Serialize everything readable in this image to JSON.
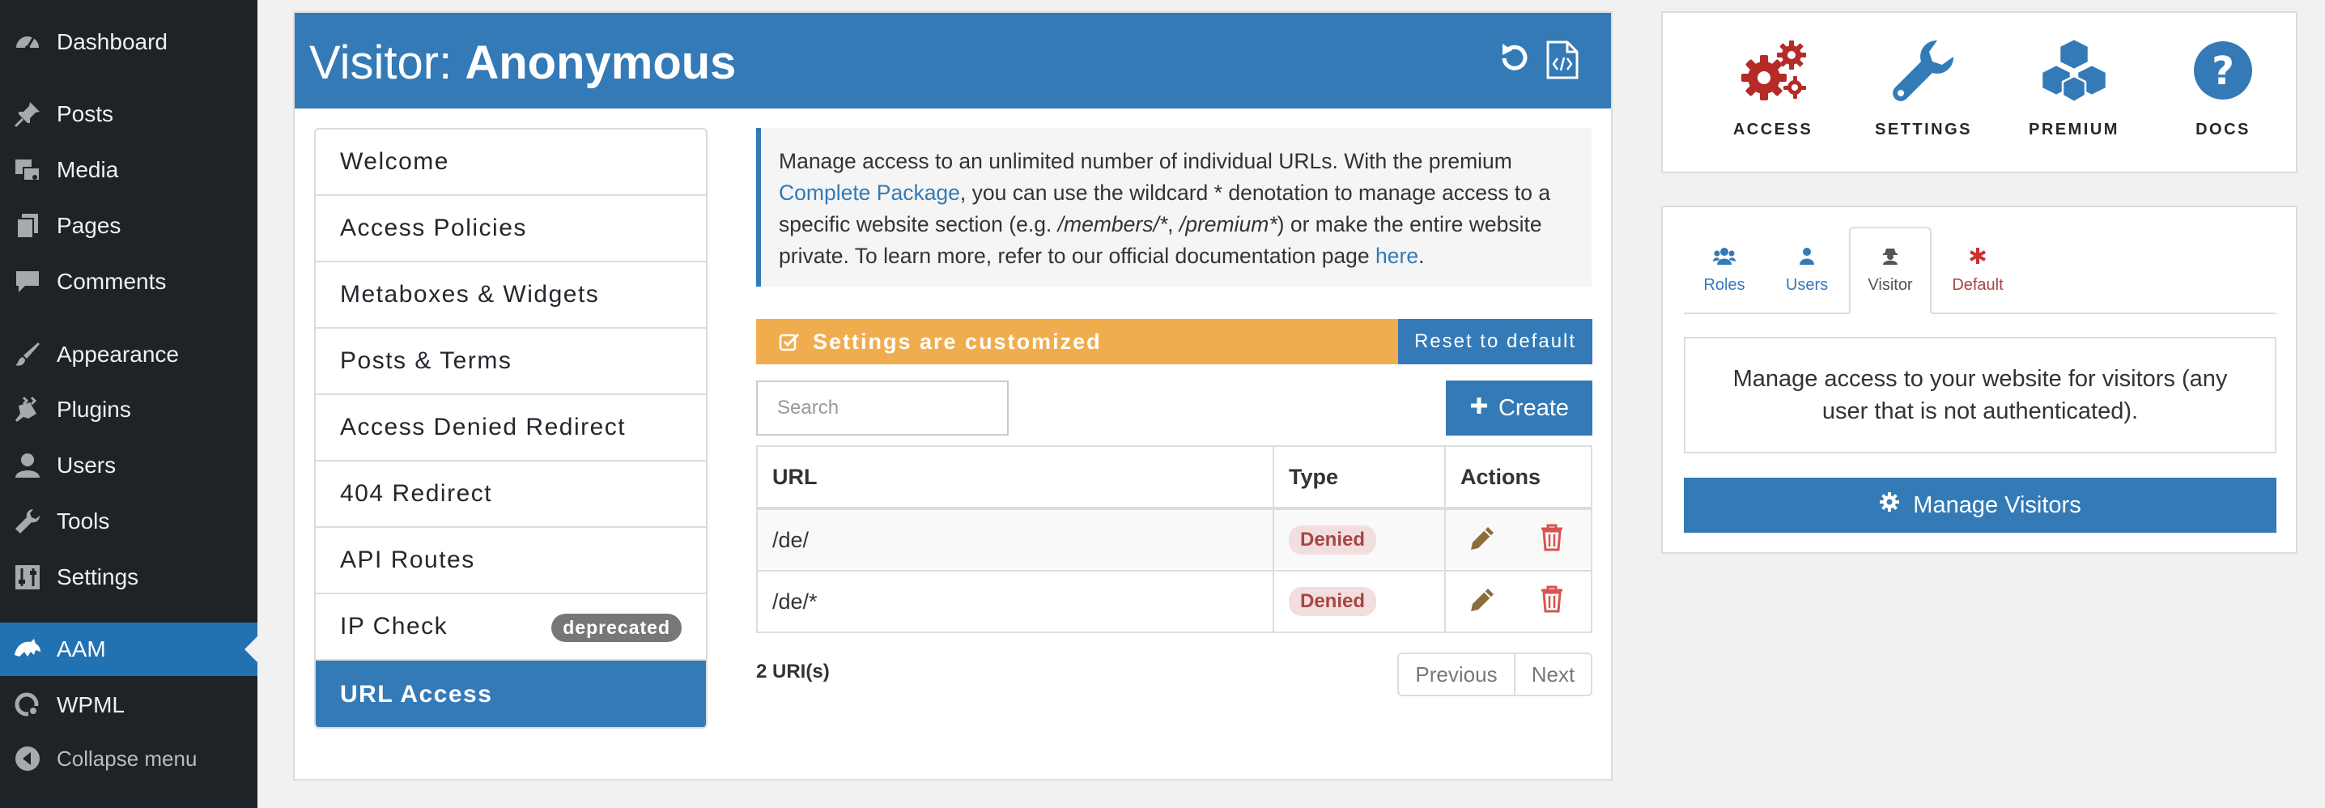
{
  "sidebar": {
    "items": [
      {
        "label": "Dashboard",
        "icon": "dashboard-icon"
      },
      {
        "label": "Posts",
        "icon": "pin-icon"
      },
      {
        "label": "Media",
        "icon": "media-icon"
      },
      {
        "label": "Pages",
        "icon": "pages-icon"
      },
      {
        "label": "Comments",
        "icon": "comment-icon"
      },
      {
        "label": "Appearance",
        "icon": "brush-icon"
      },
      {
        "label": "Plugins",
        "icon": "plugin-icon"
      },
      {
        "label": "Users",
        "icon": "user-icon"
      },
      {
        "label": "Tools",
        "icon": "wrench-icon"
      },
      {
        "label": "Settings",
        "icon": "settings-sliders-icon"
      },
      {
        "label": "AAM",
        "icon": "aam-logo-icon"
      },
      {
        "label": "WPML",
        "icon": "wpml-icon"
      }
    ],
    "collapse_label": "Collapse menu",
    "active": "AAM"
  },
  "header": {
    "prefix": "Visitor: ",
    "subject": "Anonymous",
    "icons": [
      "reset-icon",
      "export-code-icon"
    ]
  },
  "menu": {
    "items": [
      {
        "label": "Welcome"
      },
      {
        "label": "Access Policies"
      },
      {
        "label": "Metaboxes & Widgets"
      },
      {
        "label": "Posts & Terms"
      },
      {
        "label": "Access Denied Redirect"
      },
      {
        "label": "404 Redirect"
      },
      {
        "label": "API Routes"
      },
      {
        "label": "IP Check",
        "badge": "deprecated"
      },
      {
        "label": "URL Access"
      }
    ],
    "active": "URL Access"
  },
  "info": {
    "text1": "Manage access to an unlimited number of individual URLs. With the premium ",
    "link1": "Complete Package",
    "text2": ", you can use the wildcard * denotation to manage access to a specific website section (e.g. ",
    "em1": "/members/*",
    "text3": ", ",
    "em2": "/premium*",
    "text4": ") or make the entire website private. To learn more, refer to our official documentation page ",
    "link2": "here",
    "text5": "."
  },
  "status": {
    "customized_label": "Settings are customized",
    "reset_label": "Reset to default"
  },
  "search": {
    "placeholder": "Search"
  },
  "create_label": "Create",
  "table": {
    "columns": [
      "URL",
      "Type",
      "Actions"
    ],
    "rows": [
      {
        "url": "/de/",
        "type": "Denied"
      },
      {
        "url": "/de/*",
        "type": "Denied"
      }
    ]
  },
  "footer": {
    "count": "2 URI(s)",
    "previous": "Previous",
    "next": "Next"
  },
  "tools": [
    {
      "label": "ACCESS",
      "icon": "gears-icon"
    },
    {
      "label": "SETTINGS",
      "icon": "wrench-icon"
    },
    {
      "label": "PREMIUM",
      "icon": "cubes-icon"
    },
    {
      "label": "DOCS",
      "icon": "question-icon"
    }
  ],
  "subject_tabs": [
    {
      "label": "Roles",
      "icon": "users-icon"
    },
    {
      "label": "Users",
      "icon": "user-icon"
    },
    {
      "label": "Visitor",
      "icon": "user-secret-icon"
    },
    {
      "label": "Default",
      "icon": "asterisk-icon"
    }
  ],
  "active_tab": "Visitor",
  "visitor_desc": "Manage access to your website for visitors (any user that is not authenticated).",
  "manage_label": "Manage Visitors",
  "colors": {
    "wp_sidebar": "#1d2327",
    "wp_active": "#2271b1",
    "aam_blue": "#337ab7",
    "warning": "#f0ad4e",
    "danger": "#a94442",
    "tool_red": "#b52b27"
  }
}
